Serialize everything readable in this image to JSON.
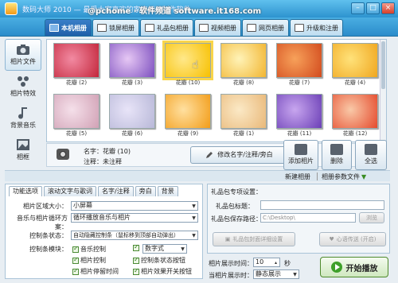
{
  "window": {
    "title": "数码大师 2010 — 最受大家喜欢的家庭相册制作软件",
    "watermark": "@pchome · 软件频道 software.it168.com",
    "minimize": "–",
    "maximize": "□",
    "close": "×"
  },
  "tabs": [
    {
      "label": "本机相册",
      "active": true
    },
    {
      "label": "锁屏相册",
      "active": false
    },
    {
      "label": "礼品包相册",
      "active": false
    },
    {
      "label": "视频相册",
      "active": false
    },
    {
      "label": "网页相册",
      "active": false
    },
    {
      "label": "升级和注册",
      "active": false
    }
  ],
  "leftnav": [
    {
      "label": "相片文件",
      "icon": "photo-file-icon",
      "active": true
    },
    {
      "label": "相片特效",
      "icon": "effects-icon",
      "active": false
    },
    {
      "label": "背景音乐",
      "icon": "music-note-icon",
      "active": false
    },
    {
      "label": "相框",
      "icon": "frame-icon",
      "active": false
    }
  ],
  "photos": [
    {
      "caption": "花瓣 (2)",
      "colors": [
        "#c3263b",
        "#f28aa2"
      ]
    },
    {
      "caption": "花瓣 (3)",
      "colors": [
        "#7c4fbf",
        "#e6c7f4"
      ]
    },
    {
      "caption": "花瓣 (10)",
      "colors": [
        "#f7c000",
        "#ffe88a"
      ],
      "selected": true
    },
    {
      "caption": "花瓣 (8)",
      "colors": [
        "#f2b530",
        "#fff3b8"
      ]
    },
    {
      "caption": "花瓣 (7)",
      "colors": [
        "#d24a1d",
        "#f7a15a"
      ]
    },
    {
      "caption": "花瓣 (4)",
      "colors": [
        "#f0a61e",
        "#ffe27a"
      ]
    },
    {
      "caption": "花瓣 (5)",
      "colors": [
        "#d1a1b5",
        "#f5e0ea"
      ]
    },
    {
      "caption": "花瓣 (6)",
      "colors": [
        "#b8b8d8",
        "#e8e4f8"
      ]
    },
    {
      "caption": "花瓣 (9)",
      "colors": [
        "#f29c18",
        "#ffe0a0"
      ]
    },
    {
      "caption": "花瓣 (1)",
      "colors": [
        "#e9b879",
        "#fbe9c6"
      ]
    },
    {
      "caption": "花瓣 (11)",
      "colors": [
        "#6b3fb6",
        "#c8a6ef"
      ]
    },
    {
      "caption": "花瓣 (12)",
      "colors": [
        "#e54a2c",
        "#f9c9a8"
      ]
    }
  ],
  "info": {
    "name_label": "名字：",
    "name_value": "花瓣 (10)",
    "note_label": "注释：",
    "note_value": "未注释",
    "edit_button": "修改名字/注释/旁白",
    "add_button": "添加相片",
    "delete_button": "删除",
    "select_all_button": "全选"
  },
  "subbar": {
    "new_album": "新建相册",
    "album_params": "相册参数文件"
  },
  "settings": {
    "tabs": [
      "功能选项",
      "滚动文字与歌词",
      "名字/注释",
      "旁白",
      "背景"
    ],
    "area_size_label": "相片区域大小：",
    "area_size_value": "小屏幕",
    "music_loop_label": "音乐与相片循环方案：",
    "music_loop_value": "循环播放音乐与相片",
    "control_label": "控制条状态：",
    "control_value": "自动隐藏控制条（鼠标移到顶部自动弹出）",
    "modules_label": "控制条模块：",
    "checkboxes": [
      "音乐控制",
      "数字式",
      "相片控制",
      "控制条状态按钮",
      "相片停留时间",
      "相片效果开关按钮"
    ],
    "digital_option": "数字式"
  },
  "gift": {
    "heading": "礼品包专项设置：",
    "title_label": "礼品包标题：",
    "path_label": "礼品包保存路径：",
    "path_value": "C:\\Desktop\\",
    "browse_button": "浏览",
    "detail_button": "礼品包封面详细设置",
    "send_button": "心语传送 (开启)"
  },
  "playback": {
    "duration_label": "相片展示时间：",
    "duration_value": "10",
    "duration_unit": "秒",
    "mode_label": "当相片展示时：",
    "mode_value": "静态展示",
    "play_button": "开始播放"
  }
}
